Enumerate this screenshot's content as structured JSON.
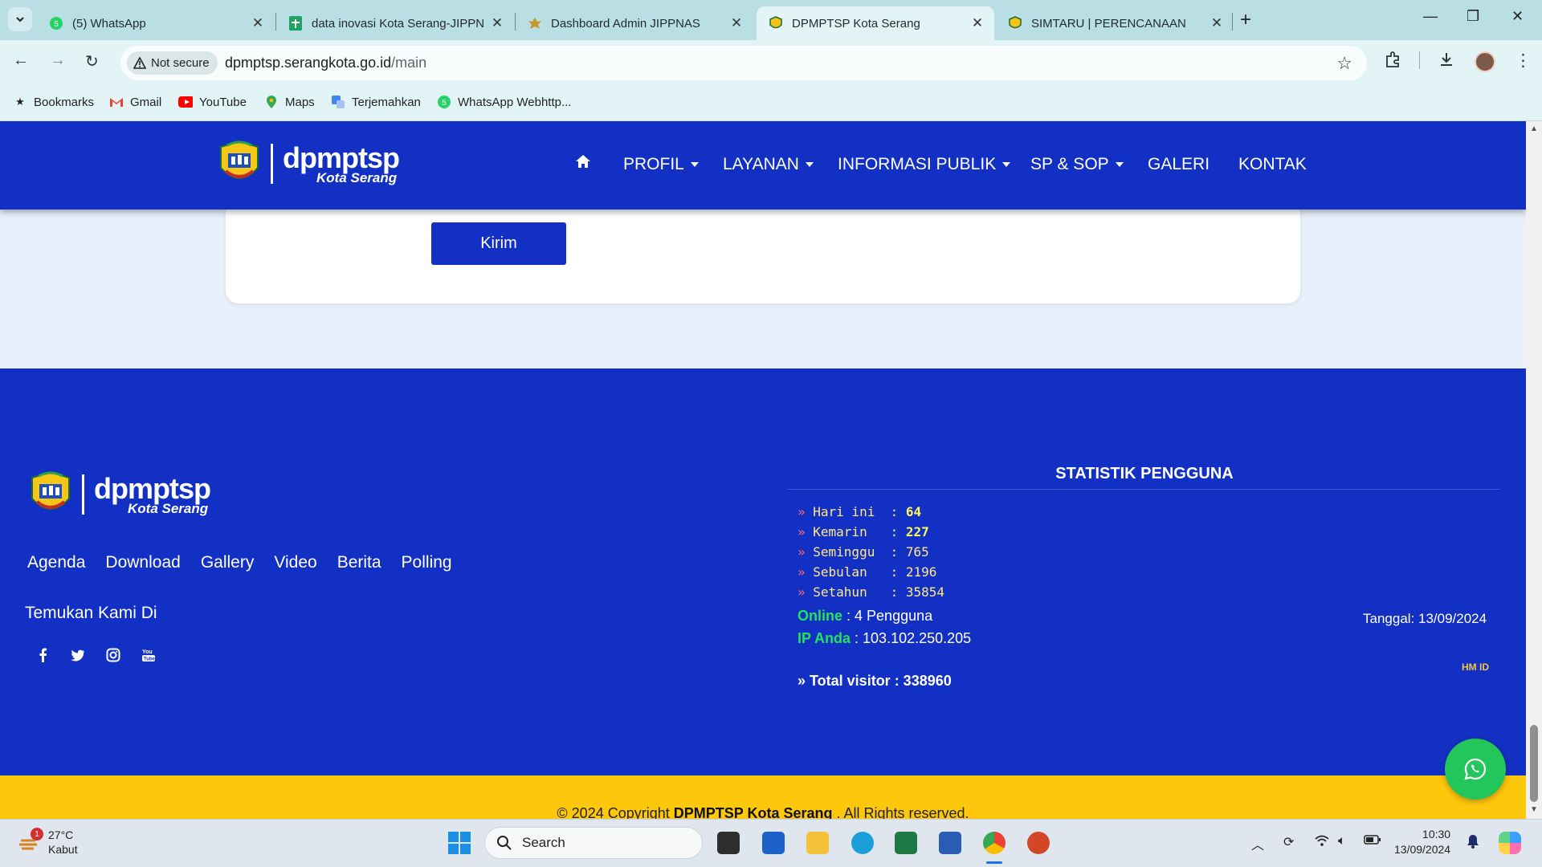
{
  "browser": {
    "tabs": [
      {
        "title": "(5) WhatsApp",
        "active": false
      },
      {
        "title": "data inovasi Kota Serang-JIPPN",
        "active": false
      },
      {
        "title": "Dashboard Admin JIPPNAS",
        "active": false
      },
      {
        "title": "DPMPTSP Kota Serang",
        "active": true
      },
      {
        "title": "SIMTARU | PERENCANAAN",
        "active": false
      }
    ],
    "security_chip": "Not secure",
    "url_host": "dpmptsp.serangkota.go.id",
    "url_path": "/main",
    "bookmarks": [
      "Bookmarks",
      "Gmail",
      "YouTube",
      "Maps",
      "Terjemahkan",
      "WhatsApp Webhttp..."
    ]
  },
  "site": {
    "logo_main": "dpmptsp",
    "logo_sub": "Kota Serang",
    "nav": [
      {
        "label": "PROFIL",
        "dropdown": true
      },
      {
        "label": "LAYANAN",
        "dropdown": true
      },
      {
        "label": "INFORMASI PUBLIK",
        "dropdown": true
      },
      {
        "label": "SP & SOP",
        "dropdown": true
      },
      {
        "label": "GALERI",
        "dropdown": false
      },
      {
        "label": "KONTAK",
        "dropdown": false
      }
    ],
    "form": {
      "submit_label": "Kirim"
    },
    "footer": {
      "links": [
        "Agenda",
        "Download",
        "Gallery",
        "Video",
        "Berita",
        "Polling"
      ],
      "find_us": "Temukan Kami Di",
      "socials": [
        "facebook-icon",
        "twitter-icon",
        "instagram-icon",
        "youtube-icon"
      ],
      "stats_title": "STATISTIK PENGGUNA",
      "stats": [
        {
          "label": "Hari ini",
          "value": "64",
          "bold": true
        },
        {
          "label": "Kemarin",
          "value": "227",
          "bold": true
        },
        {
          "label": "Seminggu",
          "value": "765",
          "bold": false
        },
        {
          "label": "Sebulan",
          "value": "2196",
          "bold": false
        },
        {
          "label": "Setahun",
          "value": "35854",
          "bold": false
        }
      ],
      "online_label": "Online",
      "online_value": "4 Pengguna",
      "ip_label": "IP Anda",
      "ip_value": "103.102.250.205",
      "tanggal": "Tanggal: 13/09/2024",
      "total_visitor": "» Total visitor : 338960",
      "hm_id": "HM ID",
      "copyright_prefix": "© 2024 Copyright",
      "copyright_org": "DPMPTSP Kota Serang",
      "copyright_suffix": ". All Rights reserved."
    }
  },
  "taskbar": {
    "temperature": "27°C",
    "weather": "Kabut",
    "weather_badge": "1",
    "search_placeholder": "Search",
    "time": "10:30",
    "date": "13/09/2024"
  },
  "colors": {
    "site_blue": "#1330c4",
    "footer_yellow": "#fdc70c",
    "whatsapp_green": "#22c65a",
    "stat_value": "#fff85a",
    "online_green": "#22e25c"
  }
}
